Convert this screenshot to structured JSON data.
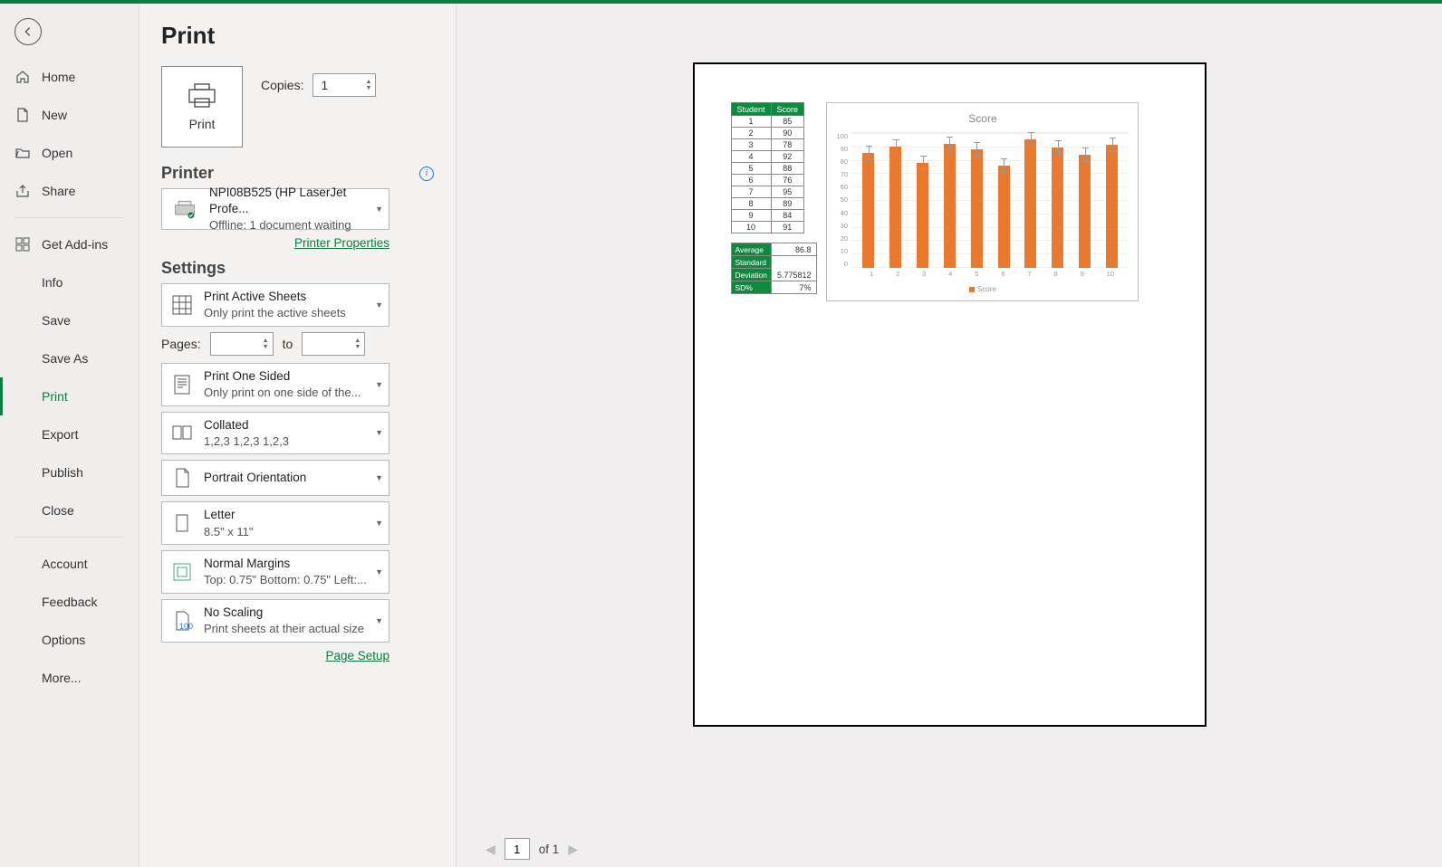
{
  "sidebar": {
    "items": [
      {
        "label": "Home",
        "icon": "home"
      },
      {
        "label": "New",
        "icon": "new"
      },
      {
        "label": "Open",
        "icon": "open"
      },
      {
        "label": "Share",
        "icon": "share"
      }
    ],
    "getAddins": "Get Add-ins",
    "fileOps": [
      "Info",
      "Save",
      "Save As",
      "Print",
      "Export",
      "Publish",
      "Close"
    ],
    "bottom": [
      "Account",
      "Feedback",
      "Options",
      "More..."
    ]
  },
  "pageTitle": "Print",
  "printBtn": "Print",
  "copiesLabel": "Copies:",
  "copiesValue": "1",
  "printerSection": {
    "title": "Printer",
    "name": "NPI08B525 (HP LaserJet Profe...",
    "status": "Offline: 1 document waiting",
    "propsLink": "Printer Properties"
  },
  "settingsSection": {
    "title": "Settings",
    "printWhat": {
      "t1": "Print Active Sheets",
      "t2": "Only print the active sheets"
    },
    "pagesLabel": "Pages:",
    "pagesTo": "to",
    "sides": {
      "t1": "Print One Sided",
      "t2": "Only print on one side of the..."
    },
    "collate": {
      "t1": "Collated",
      "t2": "1,2,3    1,2,3    1,2,3"
    },
    "orientation": {
      "t1": "Portrait Orientation"
    },
    "paper": {
      "t1": "Letter",
      "t2": "8.5\" x 11\""
    },
    "margins": {
      "t1": "Normal Margins",
      "t2": "Top: 0.75\" Bottom: 0.75\" Left:..."
    },
    "scaling": {
      "t1": "No Scaling",
      "t2": "Print sheets at their actual size",
      "sub": "100"
    },
    "pageSetupLink": "Page Setup"
  },
  "pageNav": {
    "current": "1",
    "of": "of 1"
  },
  "chart_data": {
    "type": "bar",
    "title": "Score",
    "categories": [
      "1",
      "2",
      "3",
      "4",
      "5",
      "6",
      "7",
      "8",
      "9",
      "10"
    ],
    "values": [
      85,
      90,
      78,
      92,
      88,
      76,
      95,
      89,
      84,
      91
    ],
    "series_name": "Score",
    "ylim": [
      0,
      100
    ],
    "yticks": [
      0,
      10,
      20,
      30,
      40,
      50,
      60,
      70,
      80,
      90,
      100
    ],
    "error_bar": 5.8
  },
  "preview": {
    "tableHeaders": [
      "Student",
      "Score"
    ],
    "tableRows": [
      [
        "1",
        "85"
      ],
      [
        "2",
        "90"
      ],
      [
        "3",
        "78"
      ],
      [
        "4",
        "92"
      ],
      [
        "5",
        "88"
      ],
      [
        "6",
        "76"
      ],
      [
        "7",
        "95"
      ],
      [
        "8",
        "89"
      ],
      [
        "9",
        "84"
      ],
      [
        "10",
        "91"
      ]
    ],
    "stats": [
      {
        "label": "Average",
        "value": "86.8"
      },
      {
        "label": "Standard Deviation",
        "value": "5.775812"
      },
      {
        "label": "SD%",
        "value": "7%"
      }
    ]
  }
}
